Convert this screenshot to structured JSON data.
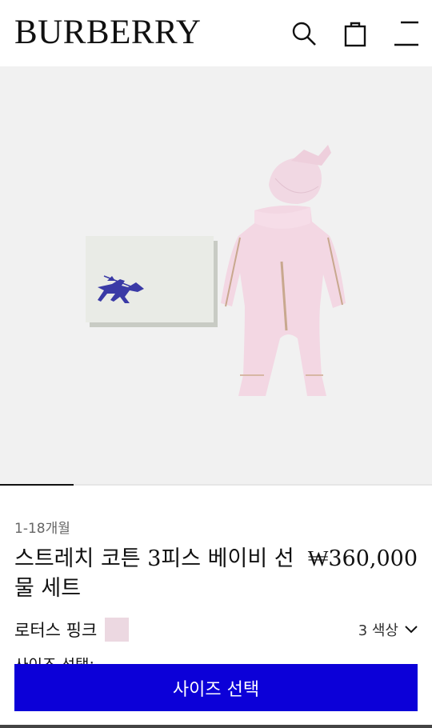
{
  "header": {
    "logo": "BURBERRY",
    "icons": [
      "search-icon",
      "shopping-bag-icon",
      "menu-icon"
    ]
  },
  "gallery": {
    "progress_fraction": 0.17
  },
  "product": {
    "age_range": "1-18개월",
    "title": "스트레치 코튼 3피스 베이비 선물 세트",
    "price": "₩360,000",
    "color_name": "로터스 핑크",
    "swatch_color": "#ecd8e1",
    "color_count": "3 색상",
    "size_label": "사이즈 선택:"
  },
  "cta": {
    "label": "사이즈 선택",
    "color": "#0c00d8"
  }
}
